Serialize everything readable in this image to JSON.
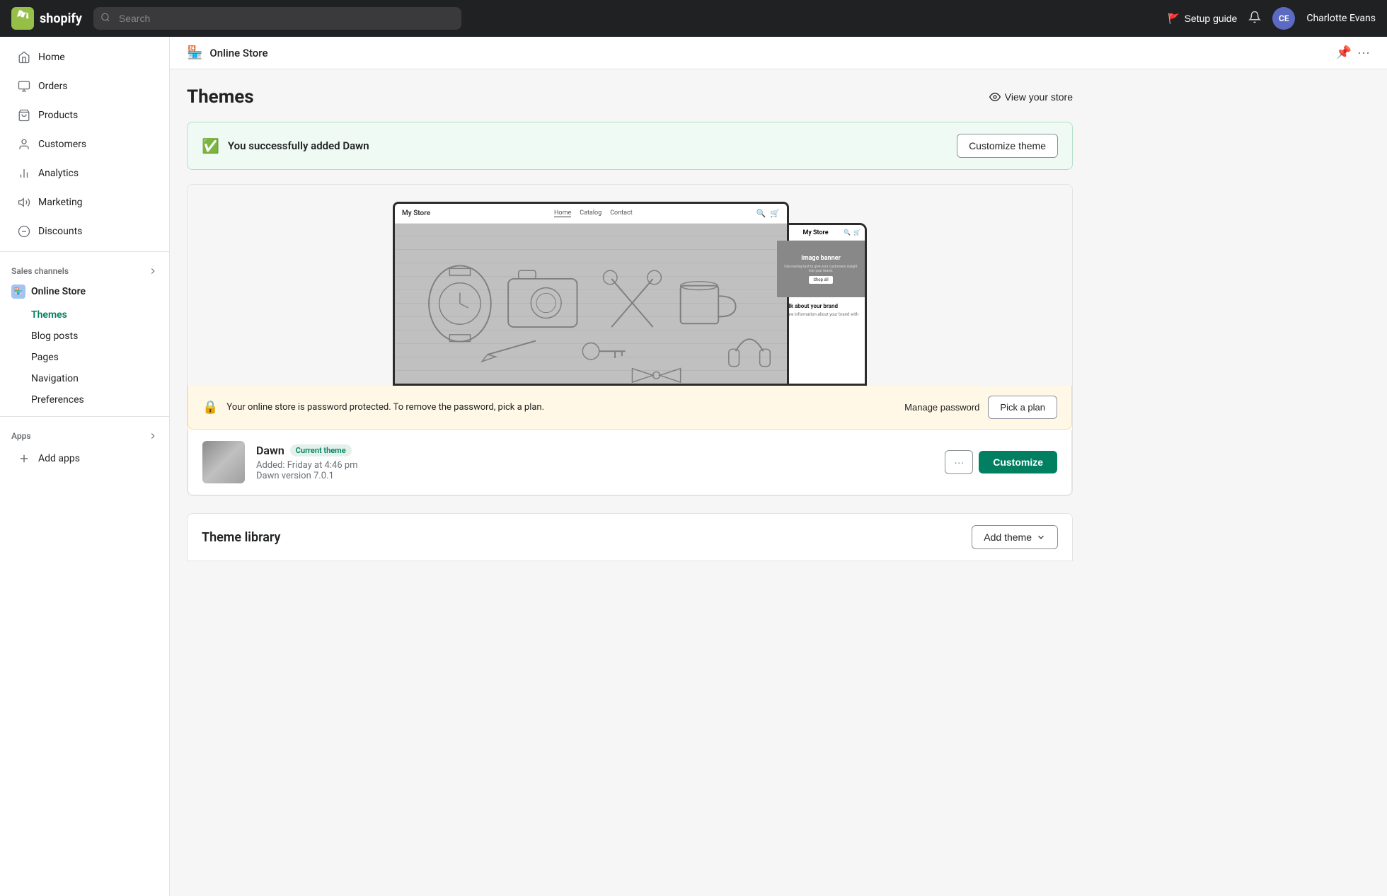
{
  "topbar": {
    "logo_text": "shopify",
    "search_placeholder": "Search",
    "setup_guide_label": "Setup guide",
    "user_initials": "CE",
    "user_name": "Charlotte Evans"
  },
  "sidebar": {
    "nav_items": [
      {
        "id": "home",
        "label": "Home",
        "icon": "home"
      },
      {
        "id": "orders",
        "label": "Orders",
        "icon": "orders"
      },
      {
        "id": "products",
        "label": "Products",
        "icon": "products"
      },
      {
        "id": "customers",
        "label": "Customers",
        "icon": "customers"
      },
      {
        "id": "analytics",
        "label": "Analytics",
        "icon": "analytics"
      },
      {
        "id": "marketing",
        "label": "Marketing",
        "icon": "marketing"
      },
      {
        "id": "discounts",
        "label": "Discounts",
        "icon": "discounts"
      }
    ],
    "sales_channels_label": "Sales channels",
    "online_store_label": "Online Store",
    "online_store_sub": [
      {
        "id": "themes",
        "label": "Themes",
        "active": true
      },
      {
        "id": "blog-posts",
        "label": "Blog posts",
        "active": false
      },
      {
        "id": "pages",
        "label": "Pages",
        "active": false
      },
      {
        "id": "navigation",
        "label": "Navigation",
        "active": false
      },
      {
        "id": "preferences",
        "label": "Preferences",
        "active": false
      }
    ],
    "apps_label": "Apps",
    "add_apps_label": "Add apps"
  },
  "page_header": {
    "title": "Online Store",
    "icon": "🏪"
  },
  "main": {
    "page_title": "Themes",
    "view_store_label": "View your store",
    "success_banner": {
      "message": "You successfully added Dawn",
      "button_label": "Customize theme"
    },
    "preview": {
      "desktop_store_name": "My Store",
      "desktop_nav": [
        "Home",
        "Catalog",
        "Contact"
      ],
      "mobile_banner_title": "Image banner",
      "mobile_banner_sub": "Use overlay text to give your customers insight into your brand. Select imagery and text that relates to your style and story.",
      "mobile_shop_btn": "Shop all",
      "mobile_section_title": "Talk about your brand",
      "mobile_section_text": "Share information about your brand with"
    },
    "password_bar": {
      "message": "Your online store is password protected. To remove the password, pick a plan.",
      "manage_label": "Manage password",
      "pick_plan_label": "Pick a plan"
    },
    "current_theme": {
      "name": "Dawn",
      "badge": "Current theme",
      "added_text": "Added: Friday at 4:46 pm",
      "version_text": "Dawn version 7.0.1",
      "more_btn_label": "···",
      "customize_btn_label": "Customize"
    },
    "theme_library": {
      "title": "Theme library",
      "add_theme_label": "Add theme"
    }
  }
}
